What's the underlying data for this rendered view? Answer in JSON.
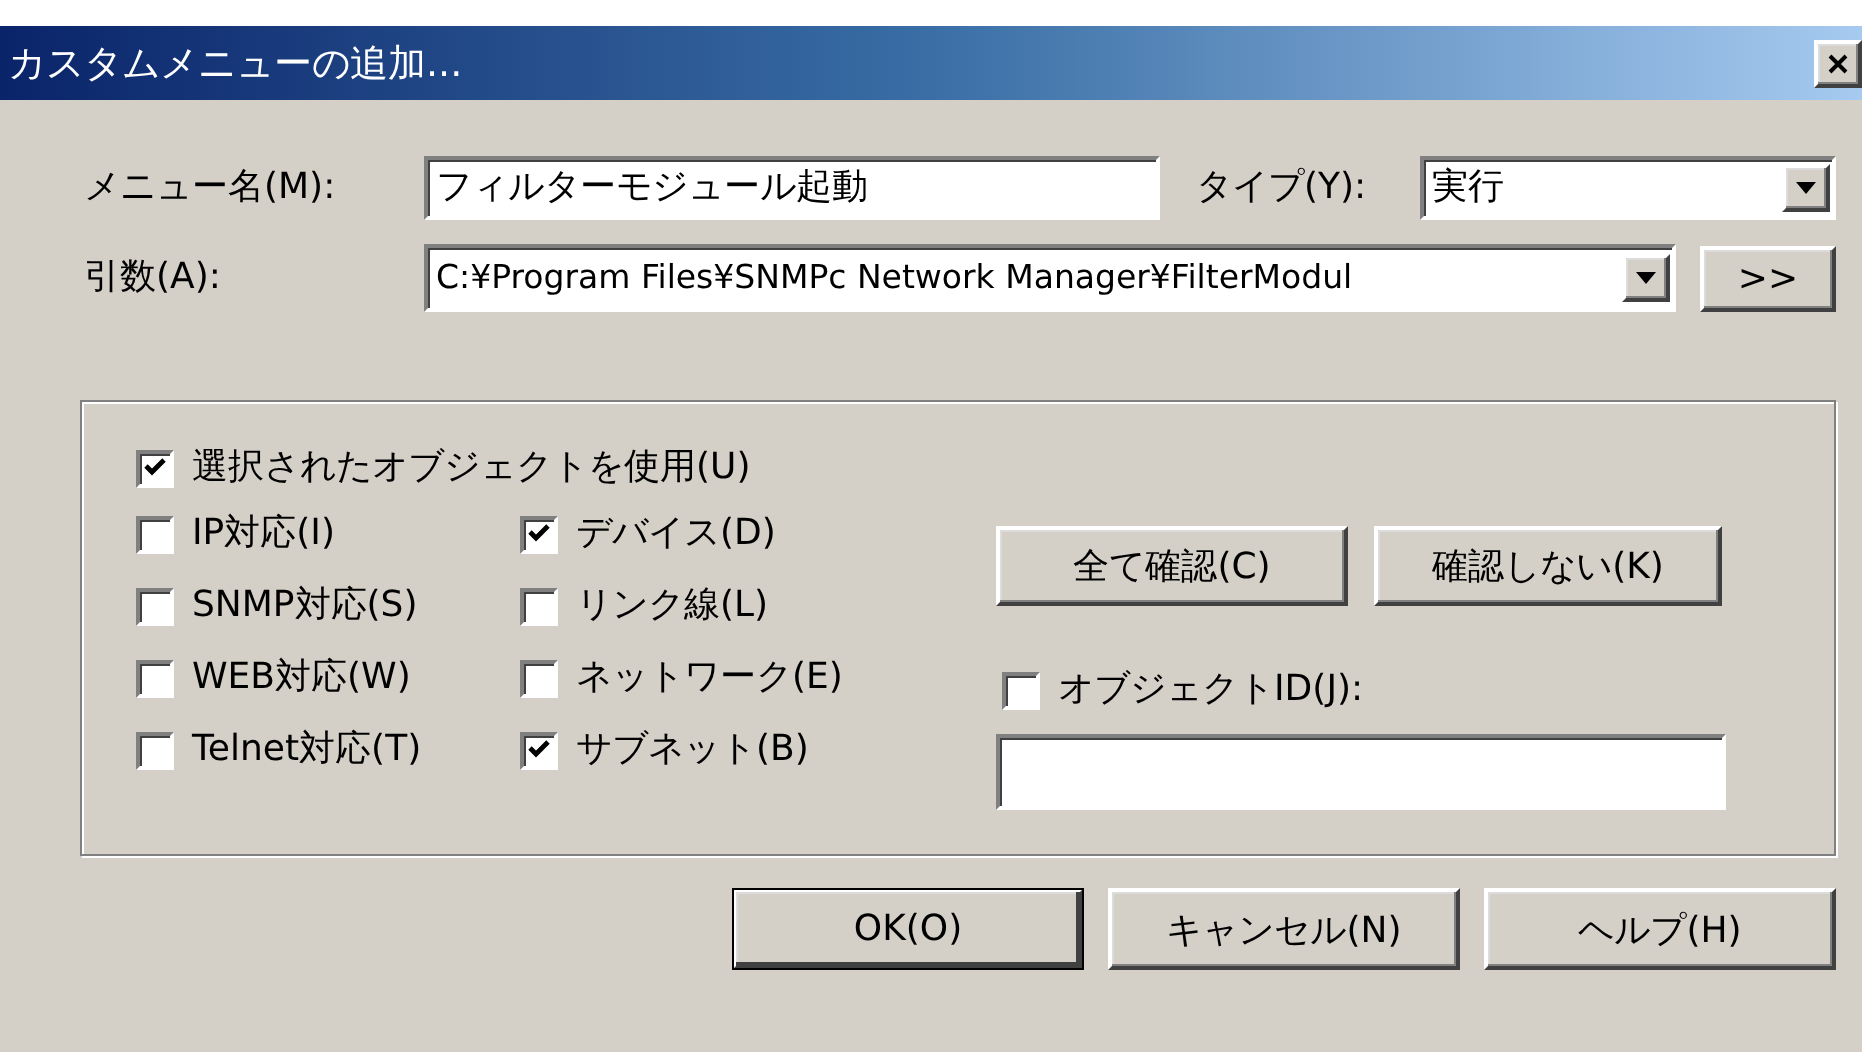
{
  "window": {
    "title": "カスタムメニューの追加..."
  },
  "menu_name": {
    "label": "メニュー名(M):",
    "value": "フィルターモジュール起動"
  },
  "type": {
    "label": "タイプ(Y):",
    "value": "実行"
  },
  "arguments": {
    "label": "引数(A):",
    "value": "C:¥Program Files¥SNMPc Network Manager¥FilterModul",
    "browse_button": ">>"
  },
  "options": {
    "use_selected": {
      "label": "選択されたオブジェクトを使用(U)",
      "checked": true
    },
    "filters": [
      {
        "label": "IP対応(I)",
        "checked": false
      },
      {
        "label": "デバイス(D)",
        "checked": true
      },
      {
        "label": "SNMP対応(S)",
        "checked": false
      },
      {
        "label": "リンク線(L)",
        "checked": false
      },
      {
        "label": "WEB対応(W)",
        "checked": false
      },
      {
        "label": "ネットワーク(E)",
        "checked": false
      },
      {
        "label": "Telnet対応(T)",
        "checked": false
      },
      {
        "label": "サブネット(B)",
        "checked": true
      }
    ],
    "confirm_all_button": "全て確認(C)",
    "no_confirm_button": "確認しない(K)",
    "object_id": {
      "label": "オブジェクトID(J):",
      "checked": false
    }
  },
  "buttons": [
    {
      "label": "OK(O)",
      "default": true
    },
    {
      "label": "キャンセル(N)",
      "default": false
    },
    {
      "label": "ヘルプ(H)",
      "default": false
    }
  ]
}
